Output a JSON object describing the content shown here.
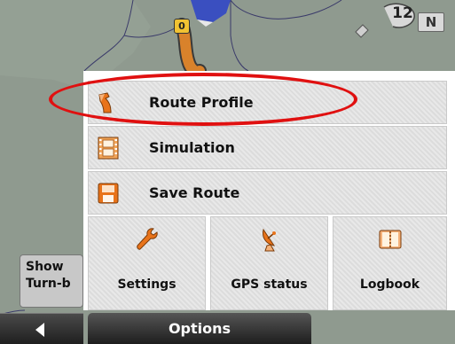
{
  "map": {
    "road_shield": "0",
    "satellite_count": "12",
    "compass": "N"
  },
  "menu": {
    "rows": [
      {
        "label": "Route Profile",
        "icon": "route-profile-icon"
      },
      {
        "label": "Simulation",
        "icon": "film-strip-icon"
      },
      {
        "label": "Save Route",
        "icon": "floppy-disk-icon"
      }
    ],
    "grid": [
      {
        "label": "Settings",
        "icon": "wrench-icon"
      },
      {
        "label": "GPS status",
        "icon": "satellite-dish-icon"
      },
      {
        "label": "Logbook",
        "icon": "logbook-icon"
      }
    ]
  },
  "left_button": {
    "line1": "Show",
    "line2": "Turn-b"
  },
  "bottom_bar": {
    "options_label": "Options"
  },
  "colors": {
    "highlight": "#e01010",
    "icon_orange": "#e8731a",
    "map_bg": "#8f9a8f"
  }
}
